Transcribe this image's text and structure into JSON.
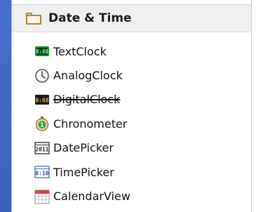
{
  "palette": {
    "category": {
      "title": "Date & Time",
      "icon": "folder-icon"
    },
    "items": [
      {
        "label": "TextClock",
        "icon": "textclock-icon",
        "deprecated": false
      },
      {
        "label": "AnalogClock",
        "icon": "analog-clock-icon",
        "deprecated": false
      },
      {
        "label": "DigitalClock",
        "icon": "digitalclock-icon",
        "deprecated": true
      },
      {
        "label": "Chronometer",
        "icon": "chronometer-icon",
        "deprecated": false
      },
      {
        "label": "DatePicker",
        "icon": "datepicker-icon",
        "deprecated": false
      },
      {
        "label": "TimePicker",
        "icon": "timepicker-icon",
        "deprecated": false
      },
      {
        "label": "CalendarView",
        "icon": "calendarview-icon",
        "deprecated": false
      }
    ]
  },
  "colors": {
    "background": "#2e56b8",
    "header_bg": "#efefef",
    "folder": "#b1832f"
  }
}
